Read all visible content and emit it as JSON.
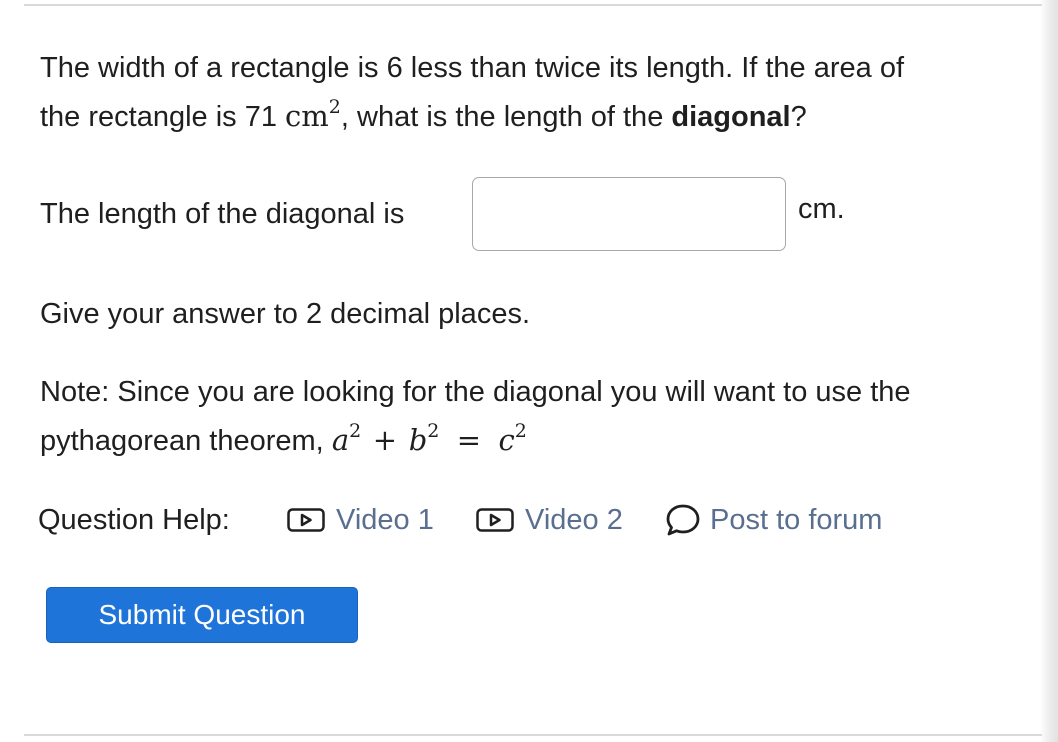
{
  "question": {
    "line1": "The width of a rectangle is 6 less than twice its length. If the area of",
    "line2_before": "the rectangle is 71 ",
    "line2_unit": "cm",
    "line2_unit_exp": "2",
    "line2_middle": ", what is the length of the ",
    "line2_bold": "diagonal",
    "line2_end": "?"
  },
  "answer": {
    "prompt": "The length of the diagonal is",
    "value": "",
    "unit": "cm."
  },
  "instruction": "Give your answer to 2 decimal places.",
  "note": {
    "line1": "Note: Since you are looking for the diagonal you will want to use the",
    "line2_text": "pythagorean theorem, ",
    "a": "a",
    "b": "b",
    "c": "c",
    "exp": "2",
    "plus": "+",
    "equals": "="
  },
  "help": {
    "label": "Question Help:",
    "links": [
      {
        "label": "Video 1",
        "icon": "video-play-icon"
      },
      {
        "label": "Video 2",
        "icon": "video-play-icon"
      },
      {
        "label": "Post to forum",
        "icon": "speech-bubble-icon"
      }
    ],
    "link_color": "#5a6f8f"
  },
  "submit": {
    "label": "Submit Question",
    "color": "#1f74d9"
  }
}
